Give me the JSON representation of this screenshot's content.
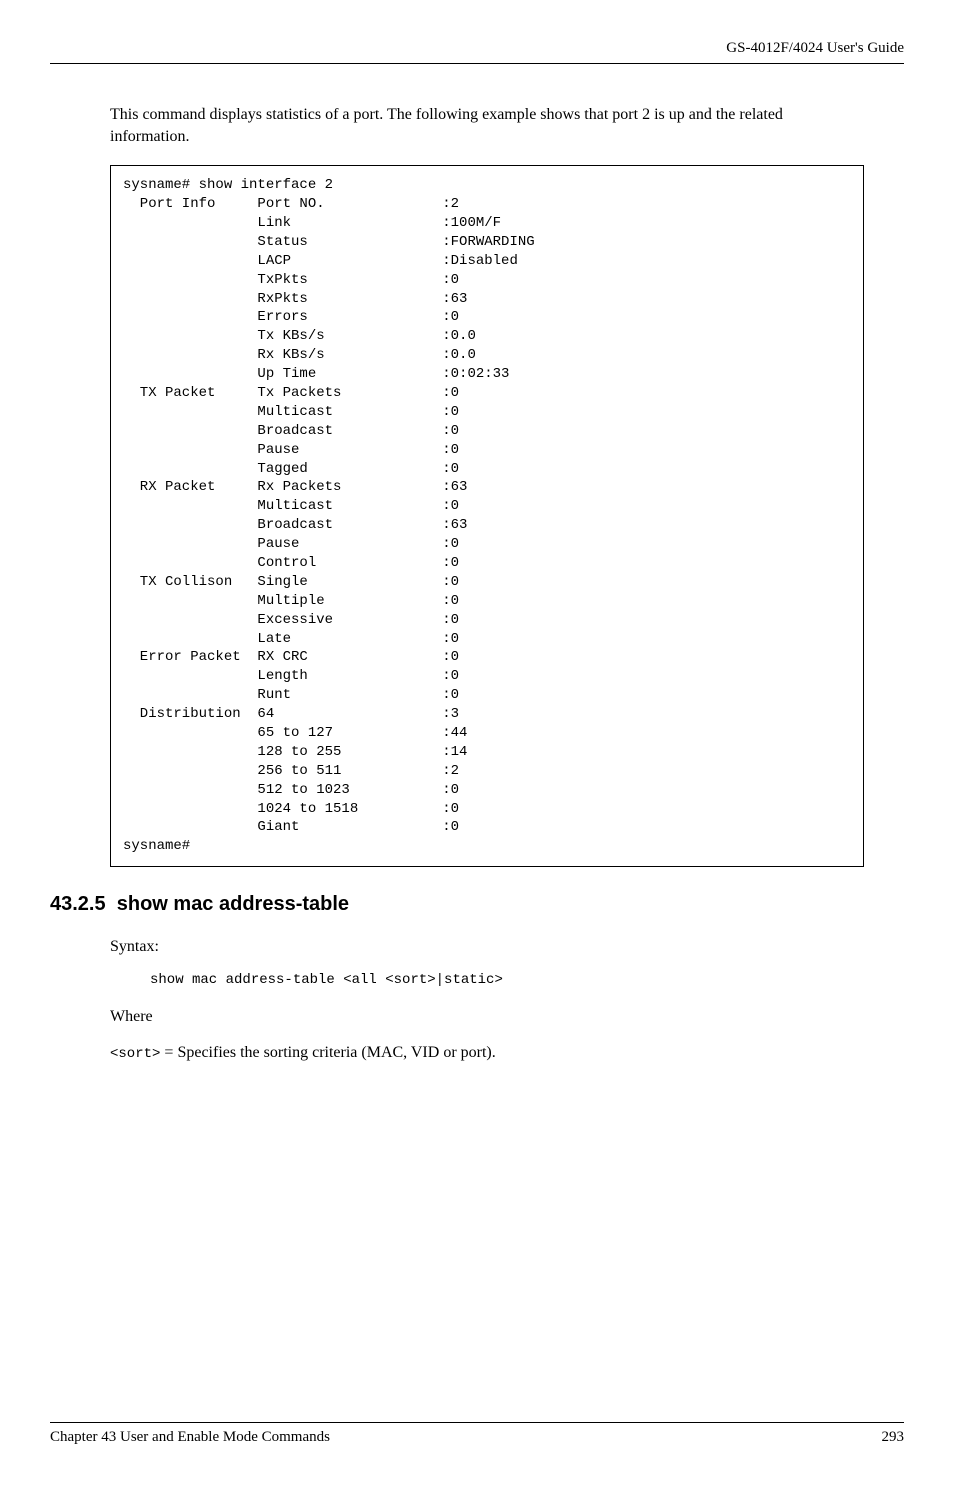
{
  "header": {
    "guide": "GS-4012F/4024 User's Guide"
  },
  "intro": "This command displays statistics of a port. The following example shows that port 2 is up and the related information.",
  "terminal": {
    "cmd": "sysname# show interface 2",
    "groups": [
      {
        "name": "Port Info",
        "rows": [
          {
            "k": "Port NO.",
            "v": "2"
          },
          {
            "k": "Link",
            "v": "100M/F"
          },
          {
            "k": "Status",
            "v": "FORWARDING"
          },
          {
            "k": "LACP",
            "v": "Disabled"
          },
          {
            "k": "TxPkts",
            "v": "0"
          },
          {
            "k": "RxPkts",
            "v": "63"
          },
          {
            "k": "Errors",
            "v": "0"
          },
          {
            "k": "Tx KBs/s",
            "v": "0.0"
          },
          {
            "k": "Rx KBs/s",
            "v": "0.0"
          },
          {
            "k": "Up Time",
            "v": "0:02:33"
          }
        ]
      },
      {
        "name": "TX Packet",
        "rows": [
          {
            "k": "Tx Packets",
            "v": "0"
          },
          {
            "k": "Multicast",
            "v": "0"
          },
          {
            "k": "Broadcast",
            "v": "0"
          },
          {
            "k": "Pause",
            "v": "0"
          },
          {
            "k": "Tagged",
            "v": "0"
          }
        ]
      },
      {
        "name": "RX Packet",
        "rows": [
          {
            "k": "Rx Packets",
            "v": "63"
          },
          {
            "k": "Multicast",
            "v": "0"
          },
          {
            "k": "Broadcast",
            "v": "63"
          },
          {
            "k": "Pause",
            "v": "0"
          },
          {
            "k": "Control",
            "v": "0"
          }
        ]
      },
      {
        "name": "TX Collison",
        "rows": [
          {
            "k": "Single",
            "v": "0"
          },
          {
            "k": "Multiple",
            "v": "0"
          },
          {
            "k": "Excessive",
            "v": "0"
          },
          {
            "k": "Late",
            "v": "0"
          }
        ]
      },
      {
        "name": "Error Packet",
        "rows": [
          {
            "k": "RX CRC",
            "v": "0"
          },
          {
            "k": "Length",
            "v": "0"
          },
          {
            "k": "Runt",
            "v": "0"
          }
        ]
      },
      {
        "name": "Distribution",
        "rows": [
          {
            "k": "64",
            "v": "3"
          },
          {
            "k": "65 to 127",
            "v": "44"
          },
          {
            "k": "128 to 255",
            "v": "14"
          },
          {
            "k": "256 to 511",
            "v": "2"
          },
          {
            "k": "512 to 1023",
            "v": "0"
          },
          {
            "k": "1024 to 1518",
            "v": "0"
          },
          {
            "k": "Giant",
            "v": "0"
          }
        ]
      }
    ],
    "prompt": "sysname#"
  },
  "section": {
    "number": "43.2.5",
    "title": "show mac address-table"
  },
  "syntax": {
    "label": "Syntax:",
    "code": "show mac address-table <all <sort>|static>"
  },
  "where": {
    "label": "Where",
    "sort_token": "<sort>",
    "sort_desc": " = Specifies the sorting criteria (MAC, VID or port)."
  },
  "footer": {
    "chapter": "Chapter 43  User and Enable Mode Commands",
    "page": "293"
  }
}
